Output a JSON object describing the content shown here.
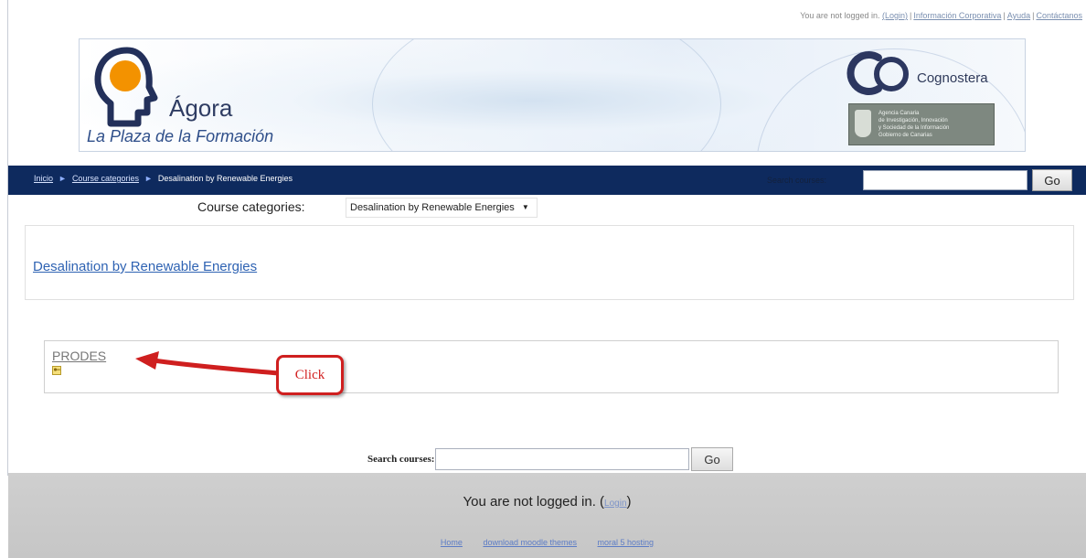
{
  "topbar": {
    "login_status": "You are not logged in.",
    "login_link": "(Login)",
    "links": [
      "Información Corporativa",
      "Ayuda",
      "Contáctanos"
    ]
  },
  "banner": {
    "title": "Ágora",
    "subtitle": "La Plaza de la Formación",
    "partner": "Cognostera",
    "agency_text": "Agencia Canaria\nde Investigación, Innovación\ny Sociedad de la Información\nGobierno de Canarias"
  },
  "nav": {
    "breadcrumb": [
      {
        "label": "Inicio",
        "link": true
      },
      {
        "label": "Course categories",
        "link": true
      },
      {
        "label": "Desalination by Renewable Energies",
        "link": false
      }
    ],
    "search_label": "Search courses:",
    "go_label": "Go"
  },
  "category_jump": {
    "label": "Course categories:",
    "selected": "Desalination by Renewable Energies"
  },
  "category": {
    "name": "Desalination by Renewable Energies"
  },
  "course": {
    "name": "PRODES"
  },
  "annotation": {
    "callout": "Click",
    "color": "#cf1f1f"
  },
  "bottom_search": {
    "label": "Search courses:",
    "go_label": "Go"
  },
  "footer": {
    "login_status": "You are not logged in.",
    "login_link": "Login",
    "links": [
      "Home",
      "download moodle themes",
      "moral 5 hosting"
    ]
  },
  "colors": {
    "navbar": "#0e2a5e",
    "link": "#2f63b3",
    "footer": "#c8c8c8"
  }
}
